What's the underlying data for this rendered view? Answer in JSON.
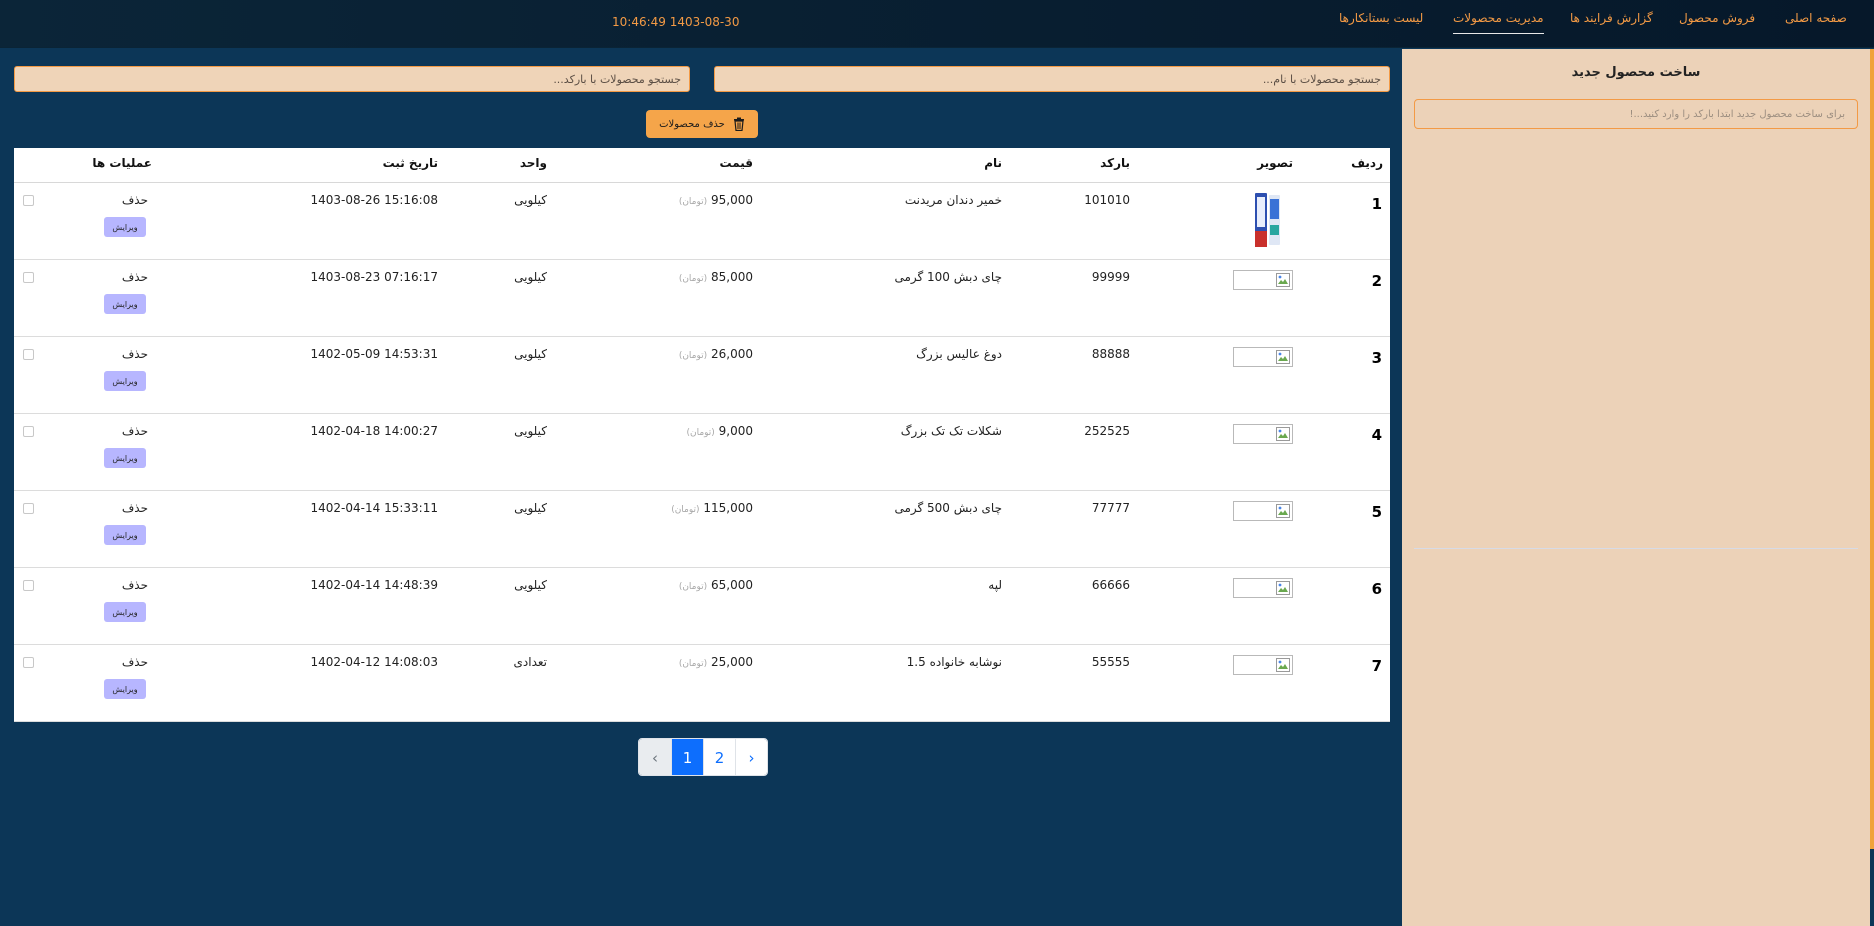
{
  "nav": {
    "items": [
      {
        "label": "صفحه اصلی"
      },
      {
        "label": "فروش محصول"
      },
      {
        "label": "گزارش فرایند ها"
      },
      {
        "label": "مدیریت محصولات"
      },
      {
        "label": "لیست بستانکارها"
      }
    ],
    "active_index": 3,
    "clock": "10:46:49 1403-08-30"
  },
  "create_panel": {
    "title": "ساخت محصول جدید",
    "barcode_placeholder": "برای ساخت محصول جدید ابتدا بارکد را وارد کنید...!"
  },
  "search": {
    "by_name_placeholder": "جستجو محصولات با نام...",
    "by_barcode_placeholder": "جستجو محصولات با بارکد..."
  },
  "toolbar": {
    "delete_products_label": "حذف محصولات",
    "trash_icon": "trash-icon"
  },
  "table": {
    "headers": {
      "index": "ردیف",
      "image": "تصویر",
      "barcode": "بارکد",
      "name": "نام",
      "price": "قیمت",
      "unit": "واحد",
      "date": "تاریخ ثبت",
      "actions": "عملیات ها"
    },
    "currency_label": "(تومان)",
    "delete_label": "حذف",
    "edit_label": "ویرایش",
    "rows": [
      {
        "index": "1",
        "barcode": "101010",
        "name": "خمیر دندان مریدنت",
        "price": "95,000",
        "unit": "کیلویی",
        "date": "15:16:08 1403-08-26",
        "has_image": true
      },
      {
        "index": "2",
        "barcode": "99999",
        "name": "چای دبش 100 گرمی",
        "price": "85,000",
        "unit": "کیلویی",
        "date": "07:16:17 1403-08-23",
        "has_image": false
      },
      {
        "index": "3",
        "barcode": "88888",
        "name": "دوغ عالیس بزرگ",
        "price": "26,000",
        "unit": "کیلویی",
        "date": "14:53:31 1402-05-09",
        "has_image": false
      },
      {
        "index": "4",
        "barcode": "252525",
        "name": "شکلات تک تک بزرگ",
        "price": "9,000",
        "unit": "کیلویی",
        "date": "14:00:27 1402-04-18",
        "has_image": false
      },
      {
        "index": "5",
        "barcode": "77777",
        "name": "چای دبش 500 گرمی",
        "price": "115,000",
        "unit": "کیلویی",
        "date": "15:33:11 1402-04-14",
        "has_image": false
      },
      {
        "index": "6",
        "barcode": "66666",
        "name": "لپه",
        "price": "65,000",
        "unit": "کیلویی",
        "date": "14:48:39 1402-04-14",
        "has_image": false
      },
      {
        "index": "7",
        "barcode": "55555",
        "name": "نوشابه خانواده 1.5",
        "price": "25,000",
        "unit": "تعدادی",
        "date": "14:08:03 1402-04-12",
        "has_image": false
      }
    ]
  },
  "pagination": {
    "prev_label": "‹",
    "pages": [
      "1",
      "2"
    ],
    "next_label": "›",
    "active_page": "1"
  },
  "colors": {
    "background": "#0c3657",
    "nav_background": "#071c2d",
    "accent": "#f39a45",
    "panel": "#ecd2b8",
    "edit_button": "#b7b6ff",
    "page_active": "#0d6efd"
  }
}
